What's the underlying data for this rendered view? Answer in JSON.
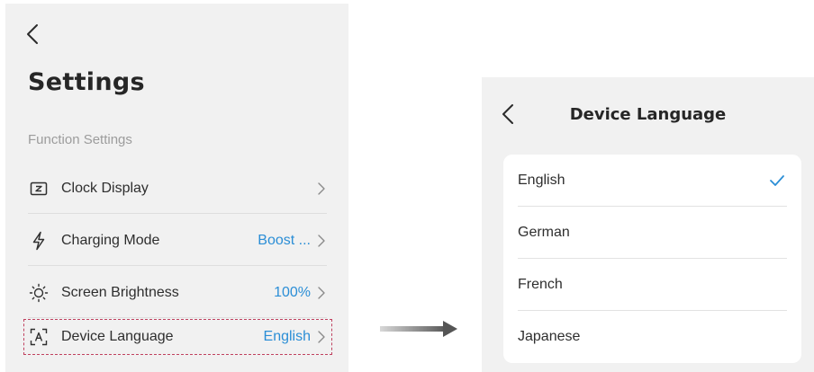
{
  "settings_screen": {
    "back_icon": "chevron-left-icon",
    "title": "Settings",
    "section_label": "Function Settings",
    "rows": [
      {
        "label": "Clock Display",
        "value": "",
        "icon": "clock-display-icon"
      },
      {
        "label": "Charging Mode",
        "value": "Boost ...",
        "icon": "lightning-icon"
      },
      {
        "label": "Screen Brightness",
        "value": "100%",
        "icon": "sun-icon"
      },
      {
        "label": "Device Language",
        "value": "English",
        "icon": "language-icon"
      }
    ],
    "highlight_color": "#c0415f"
  },
  "language_screen": {
    "back_icon": "chevron-left-icon",
    "title": "Device Language",
    "languages": [
      {
        "label": "English",
        "selected": true
      },
      {
        "label": "German",
        "selected": false
      },
      {
        "label": "French",
        "selected": false
      },
      {
        "label": "Japanese",
        "selected": false
      }
    ]
  },
  "colors": {
    "accent": "#2b8ed6",
    "screen_background": "#f1f1f1",
    "card_background": "#ffffff",
    "text": "#2e2e2e",
    "secondary_text": "#9c9c9c"
  }
}
